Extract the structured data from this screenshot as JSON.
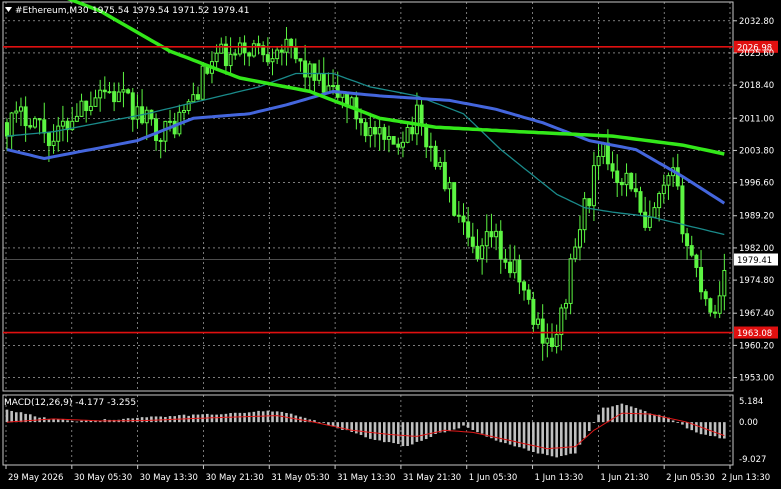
{
  "header": {
    "symbol_label": "#Ethereum,M30",
    "ohlc": "1975.54 1979.54 1971.52 1979.41"
  },
  "colors": {
    "background": "#000000",
    "grid": "#c8c8c8",
    "candle": "#5cf542",
    "sma_slow": "#33e81a",
    "sma_mid": "#4466dd",
    "sma_fast": "#1a8a8a",
    "level_line": "#e01010",
    "macd_hist": "#c0c0c0",
    "macd_signal": "#e01818",
    "axis_text": "#ffffff"
  },
  "chart_data": {
    "type": "candlestick",
    "ylim": [
      1950.0,
      2037.0
    ],
    "y_ticks": [
      "2032.80",
      "2025.60",
      "2018.40",
      "2011.00",
      "2003.80",
      "1996.60",
      "1989.20",
      "1982.00",
      "1974.80",
      "1967.40",
      "1960.20",
      "1953.00"
    ],
    "x_ticks": [
      "29 May 2026",
      "30 May 05:30",
      "30 May 13:30",
      "30 May 21:30",
      "31 May 05:30",
      "31 May 13:30",
      "31 May 21:30",
      "1 Jun 05:30",
      "1 Jun 13:30",
      "1 Jun 21:30",
      "2 Jun 05:30",
      "2 Jun 13:30"
    ],
    "levels": [
      {
        "label": "2026.98",
        "value": 2026.98
      },
      {
        "label": "1963.08",
        "value": 1963.08
      }
    ],
    "current_price": {
      "label": "1979.41",
      "value": 1979.41
    },
    "close_profile": [
      [
        0,
        2010
      ],
      [
        5,
        2012
      ],
      [
        10,
        2006
      ],
      [
        15,
        2013
      ],
      [
        20,
        2018
      ],
      [
        25,
        2015
      ],
      [
        30,
        2010
      ],
      [
        34,
        2008
      ],
      [
        38,
        2012
      ],
      [
        42,
        2020
      ],
      [
        45,
        2025
      ],
      [
        48,
        2024
      ],
      [
        52,
        2027
      ],
      [
        56,
        2026
      ],
      [
        58,
        2028
      ],
      [
        62,
        2024
      ],
      [
        65,
        2021
      ],
      [
        68,
        2017
      ],
      [
        72,
        2016
      ],
      [
        75,
        2012
      ],
      [
        78,
        2008
      ],
      [
        82,
        2004
      ],
      [
        85,
        2008
      ],
      [
        88,
        2011
      ],
      [
        92,
        2002
      ],
      [
        95,
        1994
      ],
      [
        98,
        1985
      ],
      [
        101,
        1978
      ],
      [
        104,
        1985
      ],
      [
        107,
        1979
      ],
      [
        110,
        1975
      ],
      [
        113,
        1966
      ],
      [
        116,
        1962
      ],
      [
        118,
        1961
      ],
      [
        120,
        1972
      ],
      [
        123,
        1987
      ],
      [
        126,
        1998
      ],
      [
        128,
        2003
      ],
      [
        131,
        1999
      ],
      [
        134,
        1997
      ],
      [
        137,
        1985
      ],
      [
        140,
        1992
      ],
      [
        143,
        1998
      ],
      [
        146,
        1983
      ],
      [
        149,
        1974
      ],
      [
        152,
        1967
      ],
      [
        154,
        1979
      ]
    ],
    "sma_slow": {
      "name": "",
      "values": [
        [
          0,
          2043
        ],
        [
          20,
          2035
        ],
        [
          35,
          2026
        ],
        [
          50,
          2020
        ],
        [
          65,
          2017
        ],
        [
          80,
          2011
        ],
        [
          92,
          2009
        ],
        [
          110,
          2008
        ],
        [
          130,
          2007
        ],
        [
          145,
          2005
        ],
        [
          154,
          2003
        ]
      ]
    },
    "sma_mid": {
      "name": "",
      "values": [
        [
          0,
          2004
        ],
        [
          8,
          2002
        ],
        [
          18,
          2004
        ],
        [
          28,
          2006
        ],
        [
          40,
          2011
        ],
        [
          52,
          2012
        ],
        [
          60,
          2014
        ],
        [
          70,
          2017
        ],
        [
          80,
          2016
        ],
        [
          95,
          2015
        ],
        [
          105,
          2013
        ],
        [
          115,
          2010
        ],
        [
          125,
          2006
        ],
        [
          135,
          2004
        ],
        [
          145,
          1998
        ],
        [
          154,
          1992
        ]
      ]
    },
    "sma_fast": {
      "name": "",
      "values": [
        [
          0,
          2007
        ],
        [
          10,
          2008
        ],
        [
          20,
          2010
        ],
        [
          30,
          2012
        ],
        [
          42,
          2015
        ],
        [
          54,
          2018
        ],
        [
          62,
          2021
        ],
        [
          70,
          2021
        ],
        [
          78,
          2018
        ],
        [
          88,
          2016
        ],
        [
          98,
          2012
        ],
        [
          106,
          2004
        ],
        [
          112,
          1999
        ],
        [
          118,
          1994
        ],
        [
          124,
          1991
        ],
        [
          130,
          1990
        ],
        [
          138,
          1989
        ],
        [
          146,
          1987
        ],
        [
          154,
          1985
        ]
      ]
    },
    "macd": {
      "label": "MACD(12,26,9) -4.177 -3.255",
      "ylim": [
        -9.027,
        5.184
      ],
      "y_ticks": [
        "5.184",
        "0.00",
        "-9.027"
      ],
      "hist_profile": [
        [
          0,
          3
        ],
        [
          8,
          1
        ],
        [
          15,
          0.3
        ],
        [
          25,
          0.8
        ],
        [
          35,
          1.5
        ],
        [
          45,
          2
        ],
        [
          52,
          2.5
        ],
        [
          58,
          2.8
        ],
        [
          64,
          1
        ],
        [
          70,
          -1
        ],
        [
          78,
          -4
        ],
        [
          86,
          -6
        ],
        [
          92,
          -3
        ],
        [
          98,
          -1
        ],
        [
          104,
          -4
        ],
        [
          112,
          -7
        ],
        [
          118,
          -8.5
        ],
        [
          122,
          -7.5
        ],
        [
          128,
          3.5
        ],
        [
          132,
          4.5
        ],
        [
          136,
          3
        ],
        [
          142,
          1
        ],
        [
          148,
          -2.5
        ],
        [
          154,
          -4.2
        ]
      ],
      "signal_profile": [
        [
          0,
          0
        ],
        [
          10,
          0.8
        ],
        [
          20,
          0.3
        ],
        [
          30,
          0.4
        ],
        [
          40,
          0.9
        ],
        [
          50,
          1.3
        ],
        [
          58,
          1.6
        ],
        [
          66,
          0
        ],
        [
          74,
          -2
        ],
        [
          82,
          -3
        ],
        [
          88,
          -3.5
        ],
        [
          94,
          -2
        ],
        [
          100,
          -2.5
        ],
        [
          108,
          -4.5
        ],
        [
          116,
          -6.5
        ],
        [
          122,
          -6
        ],
        [
          126,
          -2
        ],
        [
          132,
          2.2
        ],
        [
          138,
          2
        ],
        [
          146,
          0
        ],
        [
          154,
          -3.3
        ]
      ]
    }
  }
}
